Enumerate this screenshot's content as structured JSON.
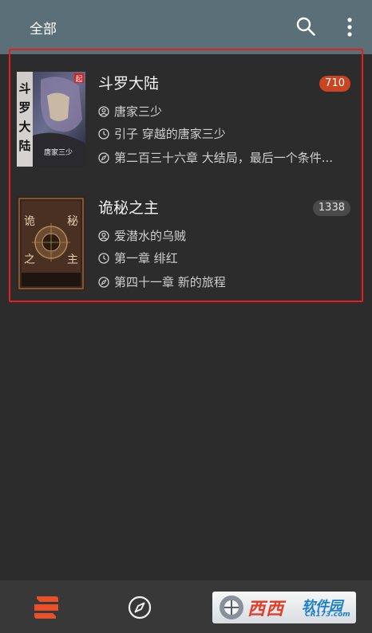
{
  "appbar": {
    "tab_label": "全部",
    "icons": [
      "search-icon",
      "more-vert-icon"
    ]
  },
  "books": [
    {
      "title": "斗罗大陆",
      "badge": "710",
      "badge_style": "new",
      "author": "唐家三少",
      "last_read": "引子 穿越的唐家三少",
      "latest_chapter": "第二百三十六章 大结局，最后一个条件...",
      "cover_text": "斗罗大陆",
      "cover_author_mark": "唐家三少",
      "cover_badge": "起"
    },
    {
      "title": "诡秘之主",
      "badge": "1338",
      "badge_style": "read",
      "author": "爱潜水的乌贼",
      "last_read": "第一章 绯红",
      "latest_chapter": "第四十一章 新的旅程",
      "cover_text": "诡秘之主"
    }
  ],
  "bottom_nav": {
    "items": [
      "bookshelf-icon",
      "discover-compass-icon"
    ]
  },
  "watermark": {
    "brand": "西西",
    "sub": "软件园",
    "url": "CR173.com"
  },
  "colors": {
    "appbar": "#5a6f78",
    "background": "#2c2c2c",
    "badge_new": "#c9441f",
    "highlight_border": "#e0211f",
    "accent": "#e8502a"
  }
}
